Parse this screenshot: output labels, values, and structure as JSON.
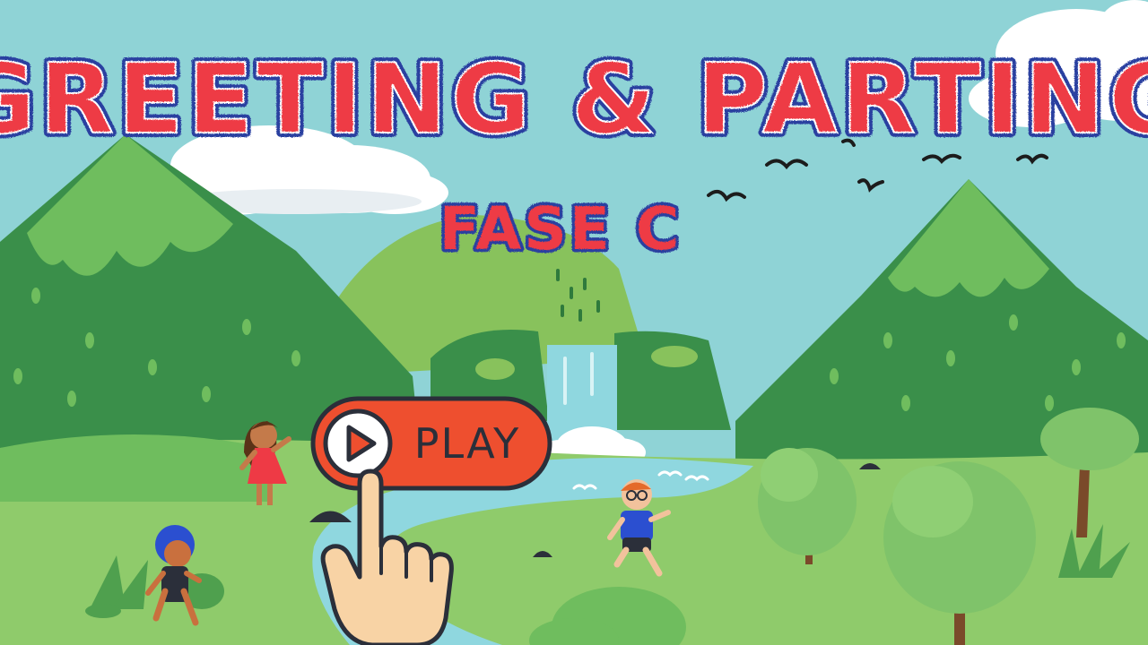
{
  "title": "GREETING & PARTING",
  "subtitle": "FASE C",
  "play_button": {
    "label": "PLAY",
    "icon": "play-icon"
  },
  "colors": {
    "sky": "#8fd3d6",
    "title_fill": "#ee3a45",
    "title_outline": "#2b3fa0",
    "button_fill": "#ee4f2f",
    "grass": "#8fcb6b",
    "mountain_dark": "#3a8f4a",
    "mountain_light": "#6fbd5e",
    "water": "#8fd7df"
  }
}
